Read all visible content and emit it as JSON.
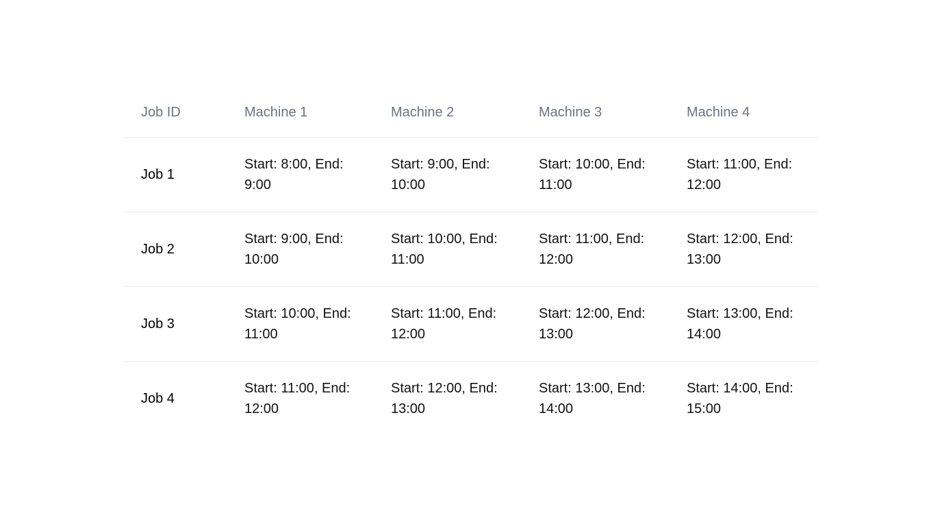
{
  "table": {
    "headers": [
      "Job ID",
      "Machine 1",
      "Machine 2",
      "Machine 3",
      "Machine 4"
    ],
    "rows": [
      {
        "job": "Job 1",
        "cells": [
          "Start: 8:00, End: 9:00",
          "Start: 9:00, End: 10:00",
          "Start: 10:00, End: 11:00",
          "Start: 11:00, End: 12:00"
        ]
      },
      {
        "job": "Job 2",
        "cells": [
          "Start: 9:00, End: 10:00",
          "Start: 10:00, End: 11:00",
          "Start: 11:00, End: 12:00",
          "Start: 12:00, End: 13:00"
        ]
      },
      {
        "job": "Job 3",
        "cells": [
          "Start: 10:00, End: 11:00",
          "Start: 11:00, End: 12:00",
          "Start: 12:00, End: 13:00",
          "Start: 13:00, End: 14:00"
        ]
      },
      {
        "job": "Job 4",
        "cells": [
          "Start: 11:00, End: 12:00",
          "Start: 12:00, End: 13:00",
          "Start: 13:00, End: 14:00",
          "Start: 14:00, End: 15:00"
        ]
      }
    ]
  },
  "colors": {
    "header_text": "#6b7280",
    "divider": "#e5e7eb"
  }
}
